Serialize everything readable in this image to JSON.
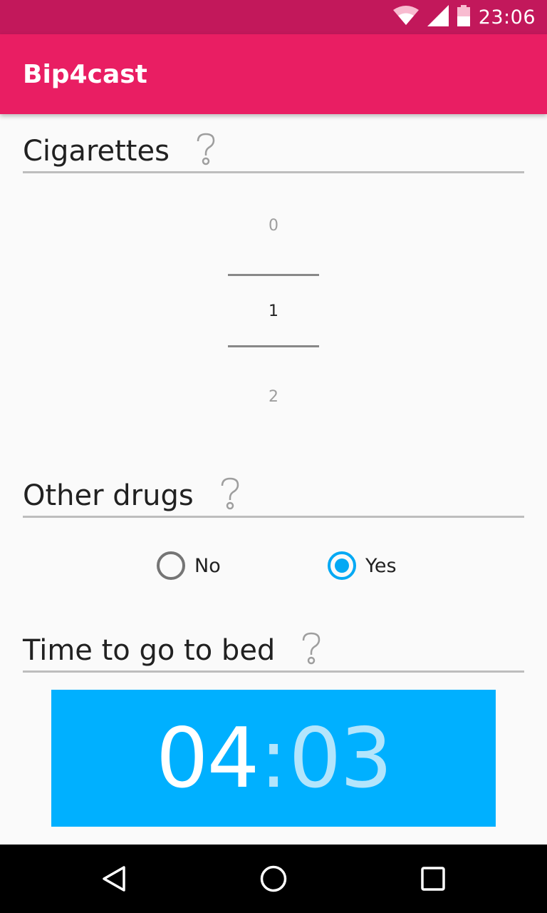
{
  "status_bar": {
    "time": "23:06",
    "icons": [
      "wifi-icon",
      "cell-signal-icon",
      "battery-icon"
    ]
  },
  "app_bar": {
    "title": "Bip4cast",
    "color": "#e91e63"
  },
  "cigarettes": {
    "title": "Cigarettes",
    "help_icon": "question-mark-icon",
    "picker": {
      "prev": "0",
      "selected": "1",
      "next": "2"
    }
  },
  "other_drugs": {
    "title": "Other drugs",
    "help_icon": "question-mark-icon",
    "options": [
      {
        "label": "No",
        "checked": false
      },
      {
        "label": "Yes",
        "checked": true
      }
    ]
  },
  "bedtime": {
    "title": "Time to go to bed",
    "help_icon": "question-mark-icon",
    "hours": "04",
    "separator": ":",
    "minutes": "03",
    "panel_color": "#00b0ff"
  },
  "nav_bar": {
    "buttons": [
      "back-icon",
      "home-icon",
      "recents-icon"
    ]
  },
  "colors": {
    "status_bar": "#c2185b",
    "accent": "#03a9f4"
  }
}
